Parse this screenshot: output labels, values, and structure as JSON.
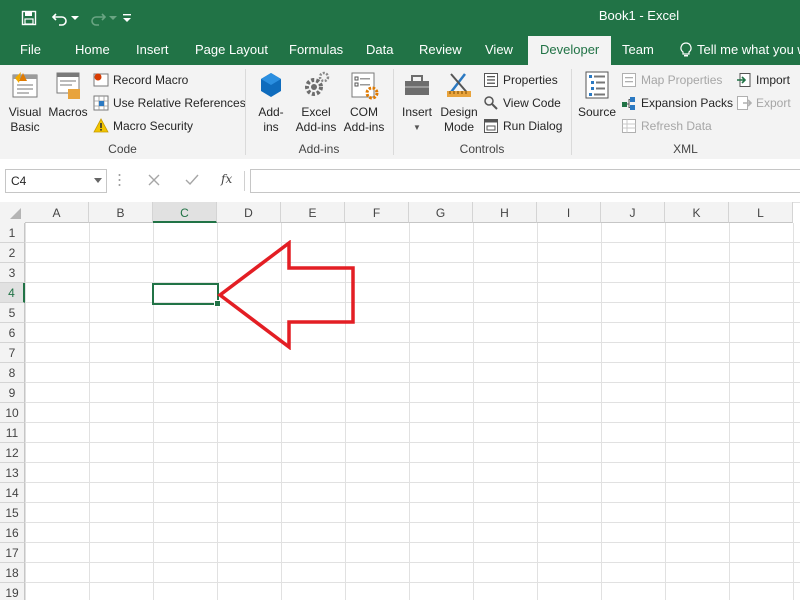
{
  "window": {
    "title": "Book1 - Excel"
  },
  "quick_access": {
    "save": "save-icon",
    "undo": "undo-icon",
    "redo": "redo-icon",
    "customize": "customize-qat-icon"
  },
  "tabs": [
    {
      "label": "File"
    },
    {
      "label": "Home"
    },
    {
      "label": "Insert"
    },
    {
      "label": "Page Layout"
    },
    {
      "label": "Formulas"
    },
    {
      "label": "Data"
    },
    {
      "label": "Review"
    },
    {
      "label": "View"
    },
    {
      "label": "Developer"
    },
    {
      "label": "Team"
    },
    {
      "label": "Tell me what you w"
    }
  ],
  "active_tab": "Developer",
  "ribbon": {
    "code": {
      "label": "Code",
      "visual_basic": [
        "Visual",
        "Basic"
      ],
      "macros": "Macros",
      "record_macro": "Record Macro",
      "relative_refs": "Use Relative References",
      "macro_security": "Macro Security"
    },
    "addins": {
      "label": "Add-ins",
      "addins": [
        "Add-",
        "ins"
      ],
      "excel_addins": [
        "Excel",
        "Add-ins"
      ],
      "com_addins": [
        "COM",
        "Add-ins"
      ]
    },
    "controls": {
      "label": "Controls",
      "insert": "Insert",
      "design_mode": [
        "Design",
        "Mode"
      ],
      "properties": "Properties",
      "view_code": "View Code",
      "run_dialog": "Run Dialog"
    },
    "xml": {
      "label": "XML",
      "source": "Source",
      "map_properties": "Map Properties",
      "expansion_packs": "Expansion Packs",
      "refresh_data": "Refresh Data",
      "import": "Import",
      "export": "Export"
    }
  },
  "formula_bar": {
    "name_box": "C4",
    "fx": "fx",
    "value": ""
  },
  "columns": [
    "A",
    "B",
    "C",
    "D",
    "E",
    "F",
    "G",
    "H",
    "I",
    "J",
    "K",
    "L"
  ],
  "rows": [
    "1",
    "2",
    "3",
    "4",
    "5",
    "6",
    "7",
    "8",
    "9",
    "10",
    "11",
    "12",
    "13",
    "14",
    "15",
    "16",
    "17",
    "18",
    "19"
  ],
  "selected_cell": "C4",
  "accent_color": "#217346",
  "annotation_color": "#e31e24"
}
